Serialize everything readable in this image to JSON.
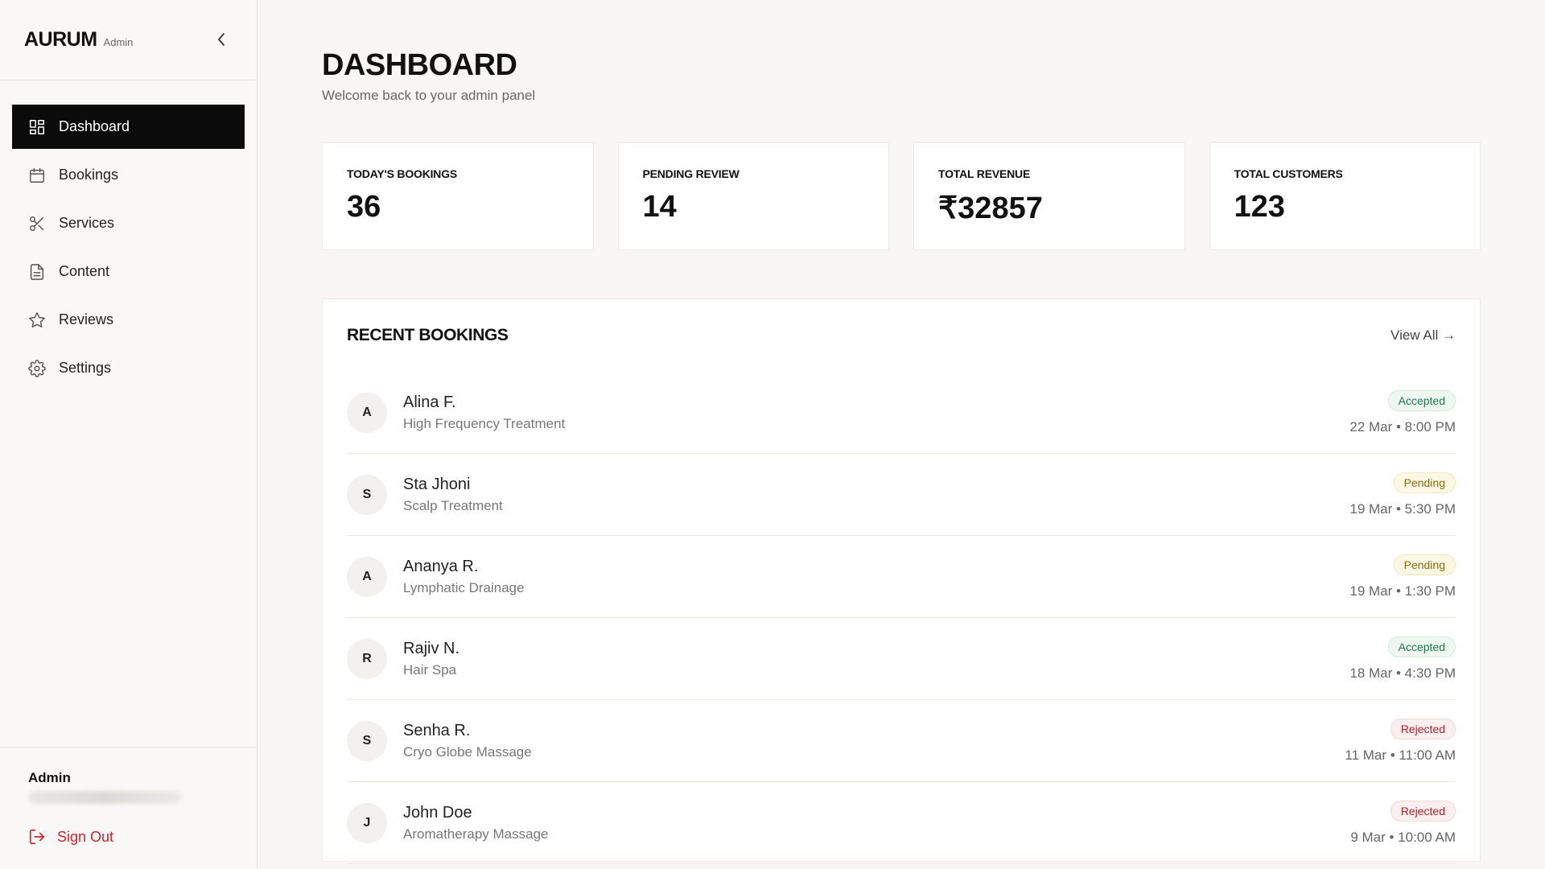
{
  "brand": {
    "name": "AURUM",
    "sub": "Admin"
  },
  "nav": {
    "items": [
      {
        "label": "Dashboard",
        "icon": "dashboard-grid-icon",
        "active": true
      },
      {
        "label": "Bookings",
        "icon": "calendar-icon"
      },
      {
        "label": "Services",
        "icon": "scissors-icon"
      },
      {
        "label": "Content",
        "icon": "document-icon"
      },
      {
        "label": "Reviews",
        "icon": "star-icon"
      },
      {
        "label": "Settings",
        "icon": "gear-icon"
      }
    ]
  },
  "footer": {
    "admin_name": "Admin",
    "sign_out": "Sign Out"
  },
  "page": {
    "title": "DASHBOARD",
    "subtitle": "Welcome back to your admin panel"
  },
  "stats": [
    {
      "label": "TODAY'S BOOKINGS",
      "value": "36"
    },
    {
      "label": "PENDING REVIEW",
      "value": "14"
    },
    {
      "label": "TOTAL REVENUE",
      "value": "₹32857"
    },
    {
      "label": "TOTAL CUSTOMERS",
      "value": "123"
    }
  ],
  "recent": {
    "title": "RECENT BOOKINGS",
    "view_all": "View All →",
    "rows": [
      {
        "initial": "A",
        "name": "Alina F.",
        "service": "High Frequency Treatment",
        "status": "Accepted",
        "when": "22 Mar • 8:00 PM"
      },
      {
        "initial": "S",
        "name": "Sta Jhoni",
        "service": "Scalp Treatment",
        "status": "Pending",
        "when": "19 Mar • 5:30 PM"
      },
      {
        "initial": "A",
        "name": "Ananya R.",
        "service": "Lymphatic Drainage",
        "status": "Pending",
        "when": "19 Mar • 1:30 PM"
      },
      {
        "initial": "R",
        "name": "Rajiv N.",
        "service": "Hair Spa",
        "status": "Accepted",
        "when": "18 Mar • 4:30 PM"
      },
      {
        "initial": "S",
        "name": "Senha R.",
        "service": "Cryo Globe Massage",
        "status": "Rejected",
        "when": "11 Mar • 11:00 AM"
      },
      {
        "initial": "J",
        "name": "John Doe",
        "service": "Aromatherapy Massage",
        "status": "Rejected",
        "when": "9 Mar • 10:00 AM"
      }
    ]
  },
  "colors": {
    "accent": "#0b0b0b",
    "danger": "#d2232a",
    "accepted": "#1d7a48",
    "pending": "#8d6b09",
    "rejected": "#b3222a"
  }
}
